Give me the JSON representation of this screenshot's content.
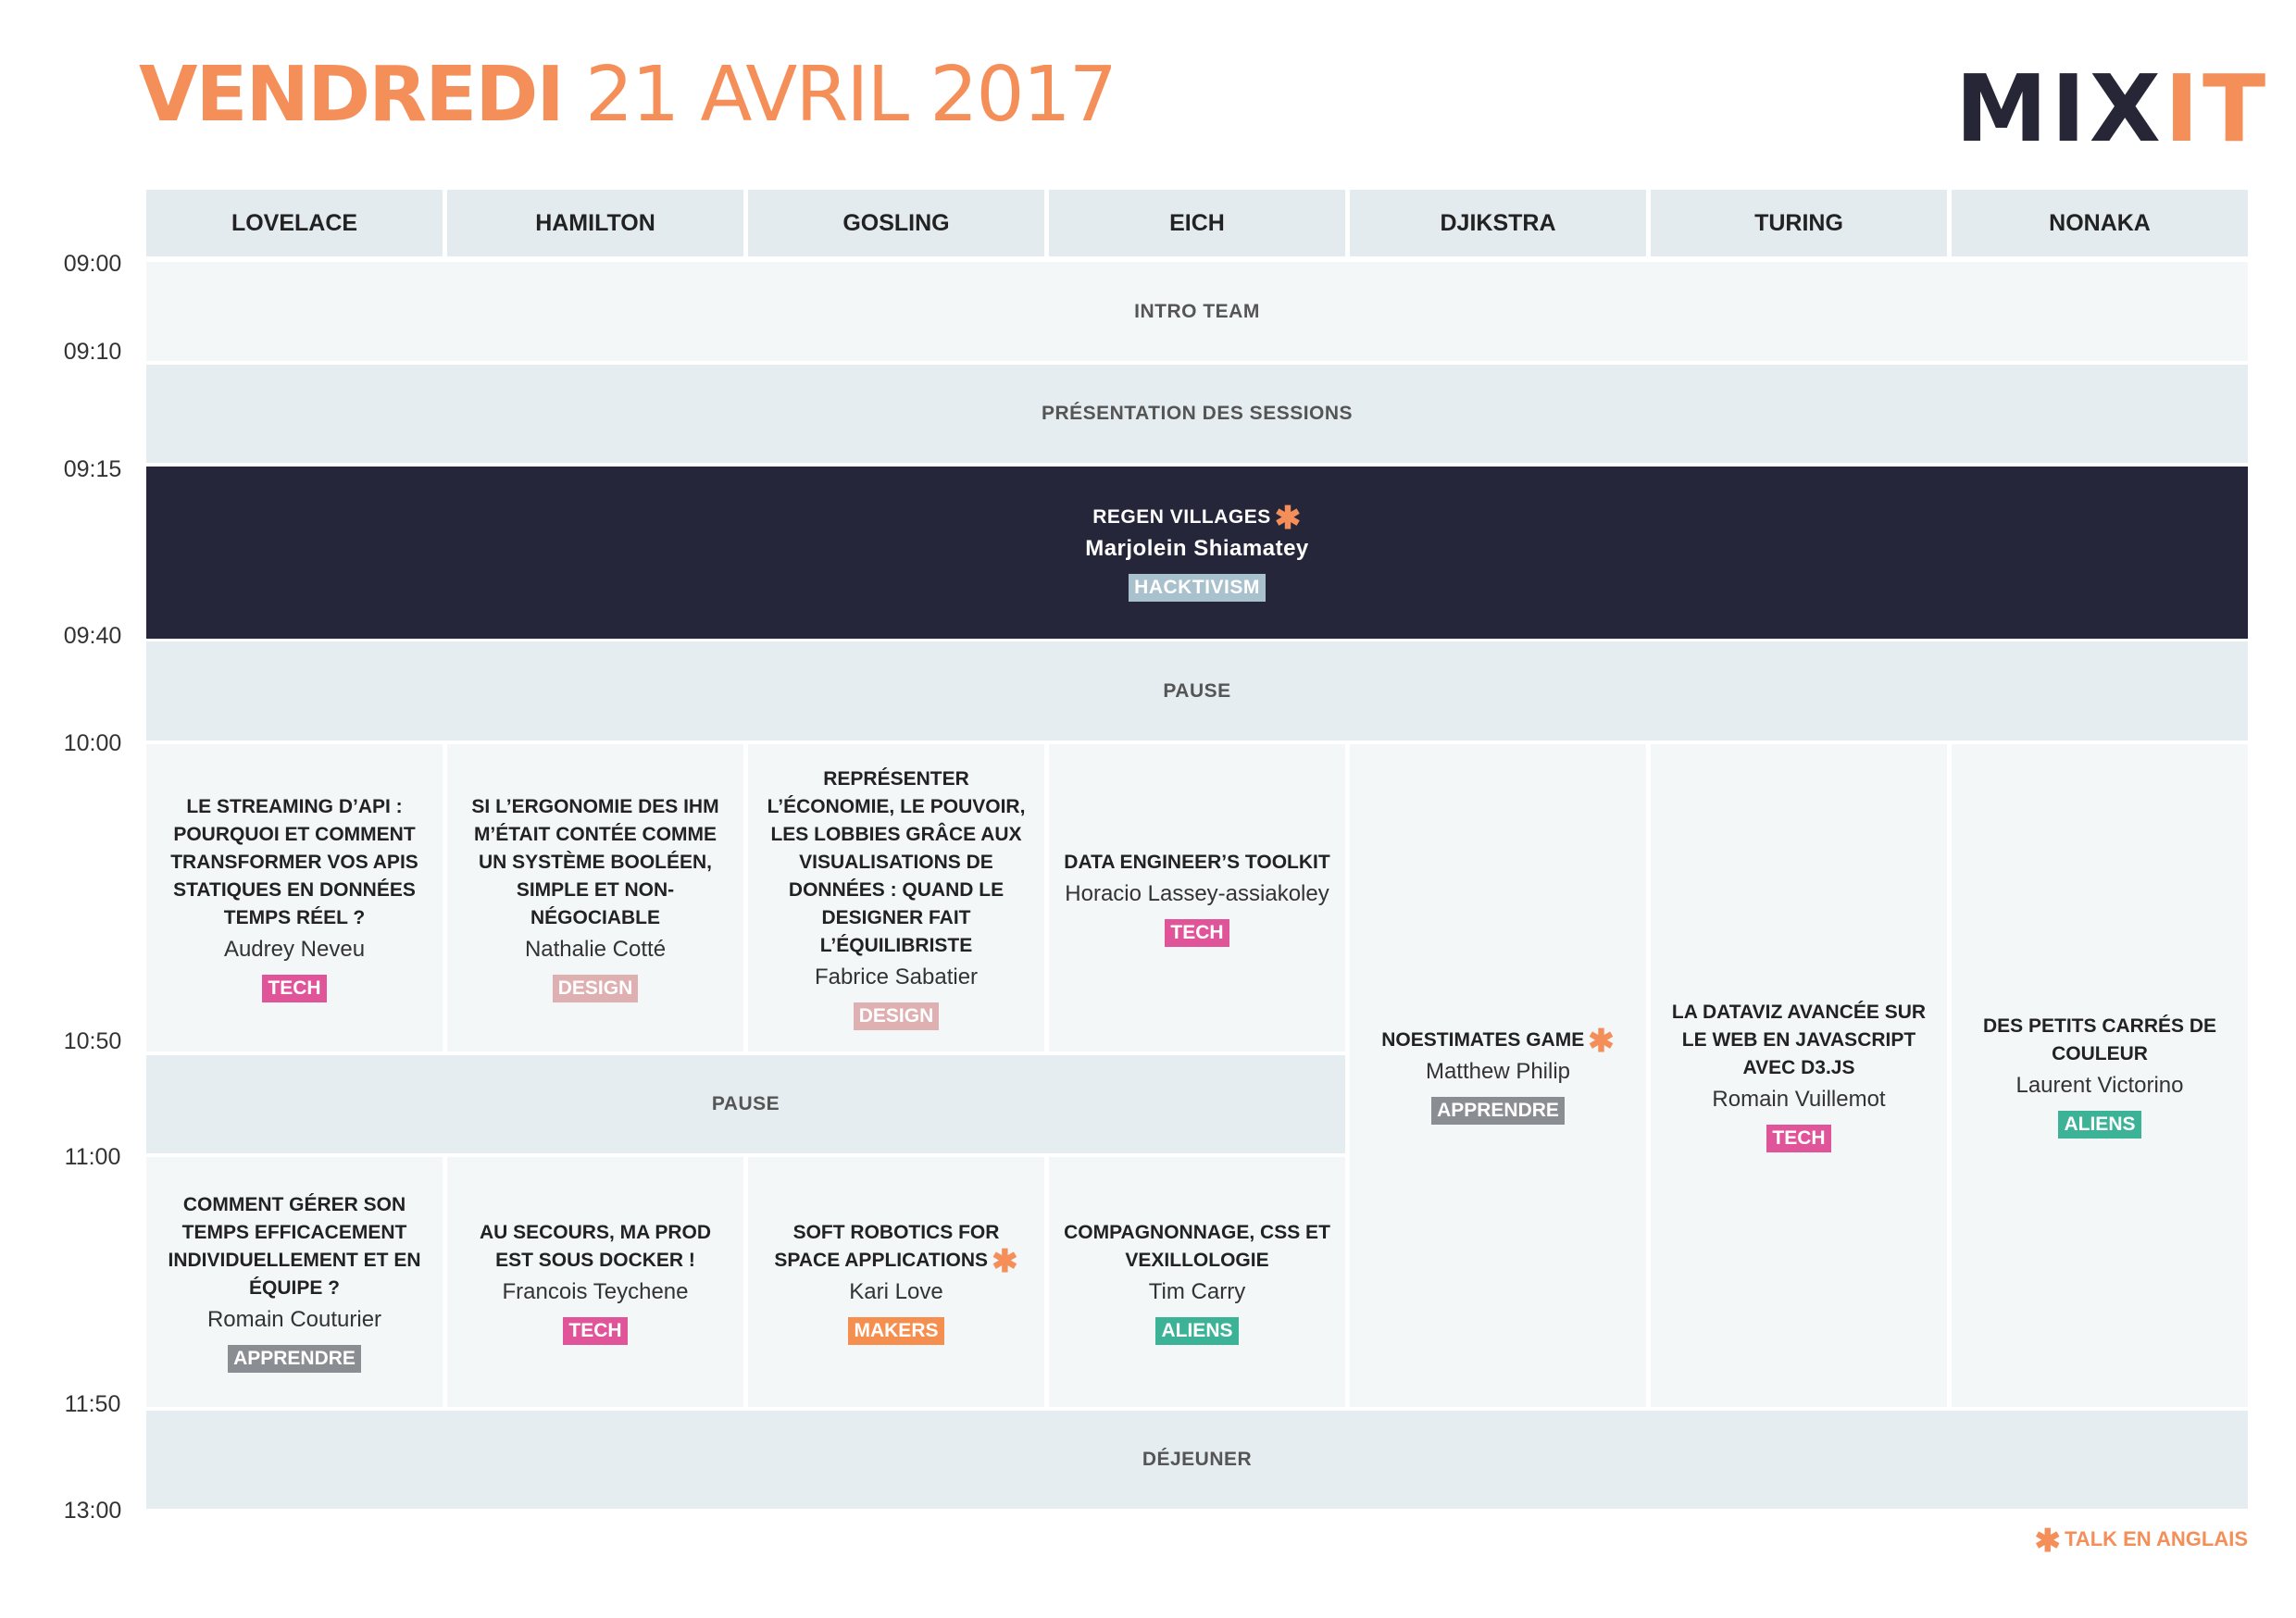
{
  "header": {
    "title_bold": "VENDREDI",
    "title_rest": "21 AVRIL 2017",
    "logo_left": "MIX",
    "logo_right": "IT"
  },
  "rooms": [
    "LOVELACE",
    "HAMILTON",
    "GOSLING",
    "EICH",
    "DJIKSTRA",
    "TURING",
    "NONAKA"
  ],
  "times": [
    "09:00",
    "09:10",
    "09:15",
    "09:40",
    "10:00",
    "10:50",
    "11:00",
    "11:50",
    "13:00"
  ],
  "bands": {
    "intro": "INTRO TEAM",
    "presentation": "PRÉSENTATION DES SESSIONS",
    "pause1": "PAUSE",
    "pause2": "PAUSE",
    "lunch": "DÉJEUNER"
  },
  "keynote": {
    "title": "REGEN VILLAGES",
    "speaker": "Marjolein Shiamatey",
    "tag": "HACKTIVISM",
    "english": true
  },
  "session1": [
    {
      "title": "LE STREAMING D’API : POURQUOI ET COMMENT TRANSFORMER VOS APIS STATIQUES EN DONNÉES TEMPS RÉEL ?",
      "speaker": "Audrey Neveu",
      "tag": "TECH"
    },
    {
      "title": "SI L’ERGONOMIE DES IHM M’ÉTAIT CONTÉE COMME UN SYSTÈME BOOLÉEN, SIMPLE ET NON-NÉGOCIABLE",
      "speaker": "Nathalie Cotté",
      "tag": "DESIGN"
    },
    {
      "title": "REPRÉSENTER L’ÉCONOMIE, LE POUVOIR, LES LOBBIES GRÂCE AUX VISUALISATIONS DE DONNÉES : QUAND LE DESIGNER FAIT L’ÉQUILIBRISTE",
      "speaker": "Fabrice Sabatier",
      "tag": "DESIGN"
    },
    {
      "title": "DATA ENGINEER’S TOOLKIT",
      "speaker": "Horacio Lassey-assiakoley",
      "tag": "TECH"
    }
  ],
  "long_sessions": [
    {
      "title": "NOESTIMATES GAME",
      "speaker": "Matthew Philip",
      "tag": "APPRENDRE",
      "english": true
    },
    {
      "title": "LA DATAVIZ AVANCÉE SUR LE WEB EN JAVASCRIPT AVEC D3.JS",
      "speaker": "Romain Vuillemot",
      "tag": "TECH"
    },
    {
      "title": "DES PETITS CARRÉS DE COULEUR",
      "speaker": "Laurent Victorino",
      "tag": "ALIENS"
    }
  ],
  "session2": [
    {
      "title": "COMMENT GÉRER SON TEMPS EFFICACEMENT INDIVIDUELLEMENT ET EN ÉQUIPE ?",
      "speaker": "Romain Couturier",
      "tag": "APPRENDRE"
    },
    {
      "title": "AU SECOURS, MA PROD EST SOUS DOCKER !",
      "speaker": "Francois Teychene",
      "tag": "TECH"
    },
    {
      "title": "SOFT ROBOTICS FOR SPACE APPLICATIONS",
      "speaker": "Kari Love",
      "tag": "MAKERS",
      "english": true
    },
    {
      "title": "COMPAGNONNAGE, CSS ET VEXILLOLOGIE",
      "speaker": "Tim Carry",
      "tag": "ALIENS"
    }
  ],
  "tag_colors": {
    "TECH": "#e0559a",
    "DESIGN": "#dfb0b2",
    "APPRENDRE": "#8a8d92",
    "ALIENS": "#3cb397",
    "MAKERS": "#f58f4f",
    "HACKTIVISM": "#a9c0cd"
  },
  "accent_color": "#f58f5a",
  "legend": "TALK EN ANGLAIS"
}
